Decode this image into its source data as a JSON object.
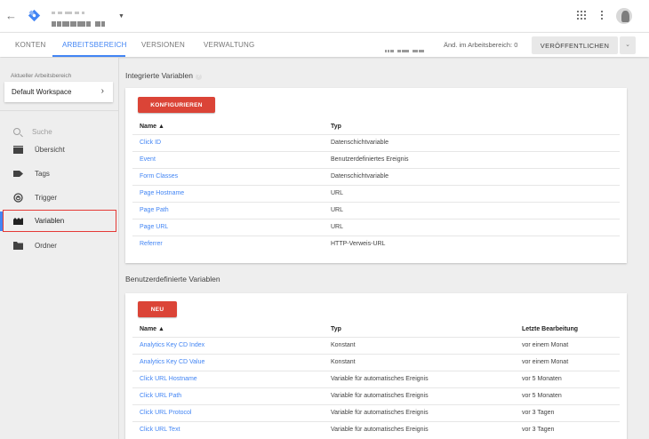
{
  "topbar": {
    "back_icon": "arrow-back-icon",
    "logo_icon": "gtm-diamond-icon",
    "apps_icon": "apps-grid-icon",
    "more_icon": "more-vert-icon",
    "brand_colors": {
      "blue": "#4285f4",
      "light_blue": "#8ab4f8"
    }
  },
  "nav": {
    "tabs": [
      {
        "label": "KONTEN"
      },
      {
        "label": "ARBEITSBEREICH"
      },
      {
        "label": "VERSIONEN"
      },
      {
        "label": "VERWALTUNG"
      }
    ],
    "changes_label": "Änd. im Arbeitsbereich: 0",
    "publish_label": "VERÖFFENTLICHEN",
    "publish_dropdown_icon": "chevron-down-icon",
    "accent": "#4285f4"
  },
  "sidebar": {
    "workspace_label": "Aktueller Arbeitsbereich",
    "workspace_value": "Default Workspace",
    "search_placeholder": "Suche",
    "items": [
      {
        "label": "Übersicht",
        "icon": "overview-icon"
      },
      {
        "label": "Tags",
        "icon": "tag-icon"
      },
      {
        "label": "Trigger",
        "icon": "trigger-icon"
      },
      {
        "label": "Variablen",
        "icon": "variables-icon",
        "active": true
      },
      {
        "label": "Ordner",
        "icon": "folder-icon"
      }
    ]
  },
  "builtin": {
    "title": "Integrierte Variablen",
    "help_icon": "help-icon",
    "button_label": "KONFIGURIEREN",
    "headers": {
      "name": "Name ▲",
      "type": "Typ"
    },
    "rows": [
      {
        "name": "Click ID",
        "type": "Datenschichtvariable"
      },
      {
        "name": "Event",
        "type": "Benutzerdefiniertes Ereignis"
      },
      {
        "name": "Form Classes",
        "type": "Datenschichtvariable"
      },
      {
        "name": "Page Hostname",
        "type": "URL"
      },
      {
        "name": "Page Path",
        "type": "URL"
      },
      {
        "name": "Page URL",
        "type": "URL"
      },
      {
        "name": "Referrer",
        "type": "HTTP-Verweis-URL"
      }
    ]
  },
  "custom": {
    "title": "Benutzerdefinierte Variablen",
    "button_label": "NEU",
    "headers": {
      "name": "Name ▲",
      "type": "Typ",
      "last_edit": "Letzte Bearbeitung"
    },
    "rows": [
      {
        "name": "Analytics Key CD Index",
        "type": "Konstant",
        "last_edit": "vor einem Monat"
      },
      {
        "name": "Analytics Key CD Value",
        "type": "Konstant",
        "last_edit": "vor einem Monat"
      },
      {
        "name": "Click URL Hostname",
        "type": "Variable für automatisches Ereignis",
        "last_edit": "vor 5 Monaten"
      },
      {
        "name": "Click URL Path",
        "type": "Variable für automatisches Ereignis",
        "last_edit": "vor 5 Monaten"
      },
      {
        "name": "Click URL Protocol",
        "type": "Variable für automatisches Ereignis",
        "last_edit": "vor 3 Tagen"
      },
      {
        "name": "Click URL Text",
        "type": "Variable für automatisches Ereignis",
        "last_edit": "vor 3 Tagen"
      }
    ]
  },
  "colors": {
    "button_red": "#db4437",
    "link_blue": "#4285f4",
    "highlight_red": "#e53935"
  }
}
